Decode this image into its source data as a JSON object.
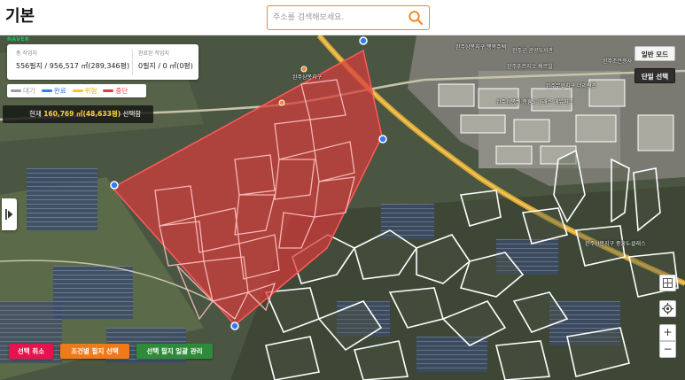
{
  "header": {
    "title": "기본",
    "search_placeholder": "주소를 검색해보세요."
  },
  "map": {
    "provider_logo": "NAVER",
    "stats": {
      "total_label": "총 작업지",
      "total_value": "556필지 / 956,517 ㎡(289,346평)",
      "done_label": "완료된 작업지",
      "done_value": "0필지 / 0 ㎡(0평)"
    },
    "legend": [
      {
        "label": "대기",
        "color": "#9e9e9e"
      },
      {
        "label": "완료",
        "color": "#2f7df6"
      },
      {
        "label": "위험",
        "color": "#f4c430"
      },
      {
        "label": "중단",
        "color": "#e53935"
      }
    ],
    "current": {
      "prefix": "현재 ",
      "value": "160,769 ㎡(48,633평)",
      "suffix": " 선택함"
    },
    "mode_buttons": {
      "normal": "일반 모드",
      "single": "단일 선택"
    },
    "controls": {
      "zoom_in": "+",
      "zoom_out": "−"
    },
    "actions": {
      "cancel": "선택 취소",
      "conditional": "조건별 필지 선택",
      "batch": "선택 필지 일괄 관리"
    },
    "place_labels": {
      "a": "완주삼봉지구",
      "b": "완주삼봉지구 행복주택",
      "c": "완주군 공공도서관",
      "d": "완주조은청사",
      "e": "완주무료지구 더리턴즈",
      "f": "완주푸르지오 쉐르빌",
      "g": "완주삼봉웰 중흥S-클래스 에듀파크",
      "h": "완주삼봉지구 중흥S-클래스"
    },
    "colors": {
      "selection_fill": "#d63a3a",
      "selection_stroke": "#ff5a5a",
      "parcel_stroke": "#ffffff",
      "accent_orange": "#f08a2c"
    }
  }
}
